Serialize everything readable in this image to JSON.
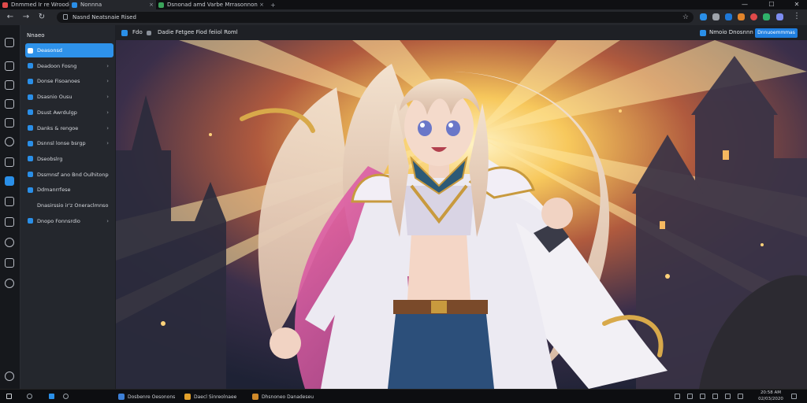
{
  "browser": {
    "tabs": [
      {
        "label": "Dnmmed Ir re Wrooded",
        "color": "#e04a4a"
      },
      {
        "label": "Nonnna",
        "color": "#2a8fe8"
      },
      {
        "label": "Dsnonad amd Varbe Mrrasonnon",
        "color": "#3aa35a"
      },
      {
        "label": "",
        "color": ""
      }
    ],
    "window_controls": [
      "—",
      "☐",
      "✕"
    ],
    "nav": {
      "back": "←",
      "forward": "→",
      "reload": "↻"
    },
    "address": "Nasnd   Neatsnaie Rised"
  },
  "app_header": {
    "left_label": "Fdo",
    "title": "Dadie Fetgee Fiod feiiol   Roml",
    "right_label": "Nmoio   Dnosnnn",
    "cta": "Dnnuoemmmas"
  },
  "sidebar": {
    "heading": "Nnaeo",
    "items": [
      {
        "label": "Deasonsd",
        "chevron": "",
        "selected": true
      },
      {
        "label": "Deadoon Fosng",
        "chevron": "›"
      },
      {
        "label": "Donse Fisoanoes",
        "chevron": "›"
      },
      {
        "label": "Dsasnio Ousu",
        "chevron": "›"
      },
      {
        "label": "Dsust Awrdulgp",
        "chevron": "›"
      },
      {
        "label": "Danks & rengoe",
        "chevron": "›"
      },
      {
        "label": "Dsnnsl lonse bsrgp",
        "chevron": "›"
      },
      {
        "label": "Dseobslrg",
        "chevron": ""
      },
      {
        "label": "Dssmnsf ano Bnd Oulhitonp",
        "chevron": "›"
      },
      {
        "label": "Ddmanrrfese",
        "chevron": ""
      },
      {
        "label": "Dnasirssio ir'z Oneraclmnso",
        "chevron": ""
      },
      {
        "label": "Dnopo Fonnsrdio",
        "chevron": "›"
      }
    ]
  },
  "taskbar": {
    "apps": [
      {
        "label": "Dosbenre Oesonons",
        "color": "#3d7fd6"
      },
      {
        "label": "Daecl Sinreolnaee",
        "color": "#e3a12b"
      },
      {
        "label": "Dhsnoneo Danadeseu",
        "color": "#d08a2a"
      }
    ],
    "clock": "20:58 AM",
    "date": "02/03/2020"
  },
  "colors": {
    "accent": "#2e92ea",
    "rail_bg": "#16181c",
    "panel_bg": "#24272d"
  }
}
